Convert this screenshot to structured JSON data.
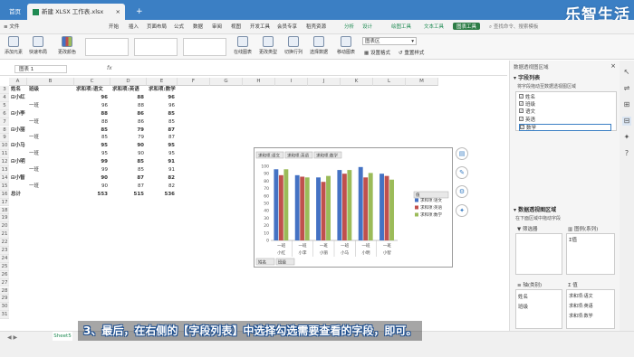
{
  "titlebar": {
    "tab_home": "首页",
    "tab_file": "新建 XLSX 工作表.xlsx",
    "new_tab": "+",
    "logo": "乐智生活"
  },
  "menu": {
    "file": "≡ 文件",
    "items": [
      "开始",
      "插入",
      "页面布局",
      "公式",
      "数据",
      "审阅",
      "视图",
      "开发工具",
      "会员专享",
      "稻壳资源"
    ],
    "green_items": [
      "分析",
      "设计"
    ],
    "hl_items": [
      "绘图工具",
      "文本工具",
      "图表工具"
    ],
    "search": "查找命令、搜索模板"
  },
  "ribbon": {
    "buttons": [
      "添加元素",
      "快速布局",
      "更改颜色"
    ],
    "right_buttons": [
      "在线图表",
      "更改类型",
      "切换行列",
      "选择数据",
      "移动图表"
    ],
    "selector": "图表区",
    "format_btn": "设置格式",
    "reset_btn": "重置样式"
  },
  "formula": {
    "namebox": "图表 1",
    "fx": "fx"
  },
  "grid": {
    "cols": [
      "A",
      "B",
      "C",
      "D",
      "E",
      "F",
      "G",
      "H",
      "I",
      "J",
      "K",
      "L",
      "M"
    ],
    "rows": [
      "3",
      "4",
      "5",
      "6",
      "7",
      "8",
      "9",
      "10",
      "11",
      "12",
      "13",
      "14",
      "15",
      "16",
      "17",
      "18",
      "19",
      "20",
      "21",
      "22",
      "23",
      "24",
      "25",
      "26",
      "27",
      "28",
      "29",
      "30",
      "31"
    ],
    "headers": [
      "姓名",
      "班级",
      "求和项:语文",
      "求和项:英语",
      "求和项:数学"
    ],
    "data": [
      [
        "⊟小红",
        "",
        "96",
        "88",
        "96"
      ],
      [
        "",
        "一班",
        "96",
        "88",
        "96"
      ],
      [
        "⊟小李",
        "",
        "88",
        "86",
        "85"
      ],
      [
        "",
        "一班",
        "88",
        "86",
        "85"
      ],
      [
        "⊟小丽",
        "",
        "85",
        "79",
        "87"
      ],
      [
        "",
        "一班",
        "85",
        "79",
        "87"
      ],
      [
        "⊟小马",
        "",
        "95",
        "90",
        "95"
      ],
      [
        "",
        "一班",
        "95",
        "90",
        "95"
      ],
      [
        "⊟小明",
        "",
        "99",
        "85",
        "91"
      ],
      [
        "",
        "一班",
        "99",
        "85",
        "91"
      ],
      [
        "⊟小智",
        "",
        "90",
        "87",
        "82"
      ],
      [
        "",
        "一班",
        "90",
        "87",
        "82"
      ],
      [
        "总计",
        "",
        "553",
        "515",
        "536"
      ]
    ]
  },
  "chart": {
    "field_buttons": [
      "求和项:语文",
      "求和项:英语",
      "求和项:数学"
    ],
    "axis_buttons": [
      "姓名",
      "班级"
    ],
    "legend_title": "值",
    "sidetools": [
      "chart-elements",
      "chart-style",
      "chart-filter",
      "chart-settings"
    ]
  },
  "chart_data": {
    "type": "bar",
    "categories": [
      [
        "一班",
        "小红"
      ],
      [
        "一班",
        "小李"
      ],
      [
        "一班",
        "小丽"
      ],
      [
        "一班",
        "小马"
      ],
      [
        "一班",
        "小明"
      ],
      [
        "一班",
        "小智"
      ]
    ],
    "series": [
      {
        "name": "求和项:语文",
        "color": "#4472c4",
        "values": [
          96,
          88,
          85,
          95,
          99,
          90
        ]
      },
      {
        "name": "求和项:英语",
        "color": "#c0504d",
        "values": [
          88,
          86,
          79,
          90,
          85,
          87
        ]
      },
      {
        "name": "求和项:数学",
        "color": "#9bbb59",
        "values": [
          96,
          85,
          87,
          95,
          91,
          82
        ]
      }
    ],
    "ylim": [
      0,
      100
    ],
    "yticks": [
      0,
      10,
      20,
      30,
      40,
      50,
      60,
      70,
      80,
      90,
      100
    ],
    "legend": "right",
    "grid": false
  },
  "panel": {
    "title": "数据透视图区域",
    "field_list_title": "字段列表",
    "field_hint": "将字段拖动至数据透视图区域",
    "fields": [
      {
        "label": "姓名",
        "checked": true
      },
      {
        "label": "班级",
        "checked": true
      },
      {
        "label": "语文",
        "checked": true
      },
      {
        "label": "英语",
        "checked": true
      },
      {
        "label": "数学",
        "checked": true
      }
    ],
    "area_title": "数据透视图区域",
    "area_hint": "在下面区域中拖动字段",
    "filter_label": "筛选器",
    "legend_label": "图例(系列)",
    "legend_value": "Σ值",
    "axis_label": "轴(类别)",
    "axis_values": [
      "姓名",
      "班级"
    ],
    "values_label": "值",
    "values_list": [
      "求和项:语文",
      "求和项:英语",
      "求和项:数学"
    ]
  },
  "status": {
    "sheet": "Sheet5",
    "caption": "3、最后，在右侧的【字段列表】中选择勾选需要查看的字段，即可。"
  }
}
